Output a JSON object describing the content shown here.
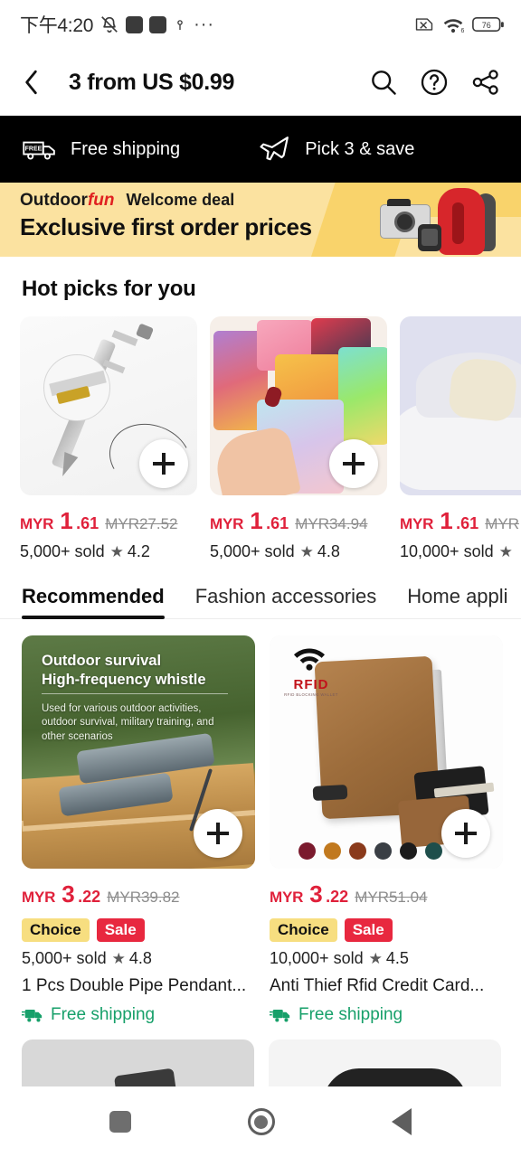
{
  "statusbar": {
    "time": "下午4:20",
    "icons_left": [
      "mute-icon",
      "app-square-icon",
      "app-square-icon",
      "location-pin-icon",
      "ellipsis-icon"
    ],
    "icons_right": [
      "no-sim-icon",
      "wifi-6-icon",
      "battery-icon"
    ],
    "battery_level": "76"
  },
  "header": {
    "back_icon": "chevron-left-icon",
    "title": "3 from US $0.99",
    "search_icon": "search-icon",
    "help_icon": "question-circle-icon",
    "share_icon": "share-icon"
  },
  "benefit_bar": {
    "items": [
      {
        "icon": "free-shipping-truck-icon",
        "label": "Free shipping"
      },
      {
        "icon": "airplane-icon",
        "label": "Pick 3 & save"
      }
    ]
  },
  "promo": {
    "brand_main": "Outdoor",
    "brand_accent": "fun",
    "welcome": "Welcome deal",
    "headline": "Exclusive first order prices",
    "bg_color": "#FBE2A0",
    "accent_color": "#F9D36B"
  },
  "hot_picks": {
    "title": "Hot picks for you",
    "items": [
      {
        "image_alt": "vernier-caliper-pen",
        "currency": "MYR",
        "price_int": "1",
        "price_dec": ".61",
        "old_price": "MYR27.52",
        "sold": "5,000+ sold",
        "rating": "4.2",
        "add_icon": "plus-icon"
      },
      {
        "image_alt": "colorful-hair-ties",
        "currency": "MYR",
        "price_int": "1",
        "price_dec": ".61",
        "old_price": "MYR34.94",
        "sold": "5,000+ sold",
        "rating": "4.8",
        "add_icon": "plus-icon"
      },
      {
        "image_alt": "white-sneaker-heel-pads",
        "currency": "MYR",
        "price_int": "1",
        "price_dec": ".61",
        "old_price": "MYR",
        "sold": "10,000+ sold",
        "rating": "",
        "add_icon": "plus-icon"
      }
    ]
  },
  "tabs": [
    {
      "label": "Recommended",
      "active": true
    },
    {
      "label": "Fashion accessories",
      "active": false
    },
    {
      "label": "Home appli",
      "active": false
    }
  ],
  "products": [
    {
      "image_alt": "outdoor-survival-whistle",
      "overlay_title": "Outdoor survival\nHigh-frequency whistle",
      "overlay_title_line1": "Outdoor survival",
      "overlay_title_line2": "High-frequency whistle",
      "overlay_sub": "Used for various outdoor activities, outdoor survival, military training, and other scenarios",
      "currency": "MYR",
      "price_int": "3",
      "price_dec": ".22",
      "old_price": "MYR39.82",
      "badges": [
        "Choice",
        "Sale"
      ],
      "sold": "5,000+ sold",
      "rating": "4.8",
      "title": "1 Pcs Double Pipe Pendant...",
      "shipping": "Free shipping",
      "add_icon": "plus-icon"
    },
    {
      "image_alt": "rfid-leather-card-wallet",
      "rfid_label": "RFID",
      "rfid_sub": "RFID BLOCKING WALLET",
      "currency": "MYR",
      "price_int": "3",
      "price_dec": ".22",
      "old_price": "MYR51.04",
      "badges": [
        "Choice",
        "Sale"
      ],
      "sold": "10,000+ sold",
      "rating": "4.5",
      "title": "Anti Thief Rfid Credit Card...",
      "shipping": "Free shipping",
      "add_icon": "plus-icon",
      "swatches": [
        "#7B1B2E",
        "#C1791F",
        "#8A3A1B",
        "#3A3F45",
        "#1C1C1C",
        "#1E4E4B"
      ]
    }
  ],
  "colors": {
    "price_red": "#E0213B",
    "sale_red": "#E8283F",
    "choice_yellow": "#F7DE80",
    "shipping_green": "#17A06A"
  },
  "navbar": {
    "recents_icon": "square-recents-icon",
    "home_icon": "circle-home-icon",
    "back_icon": "triangle-back-icon"
  }
}
